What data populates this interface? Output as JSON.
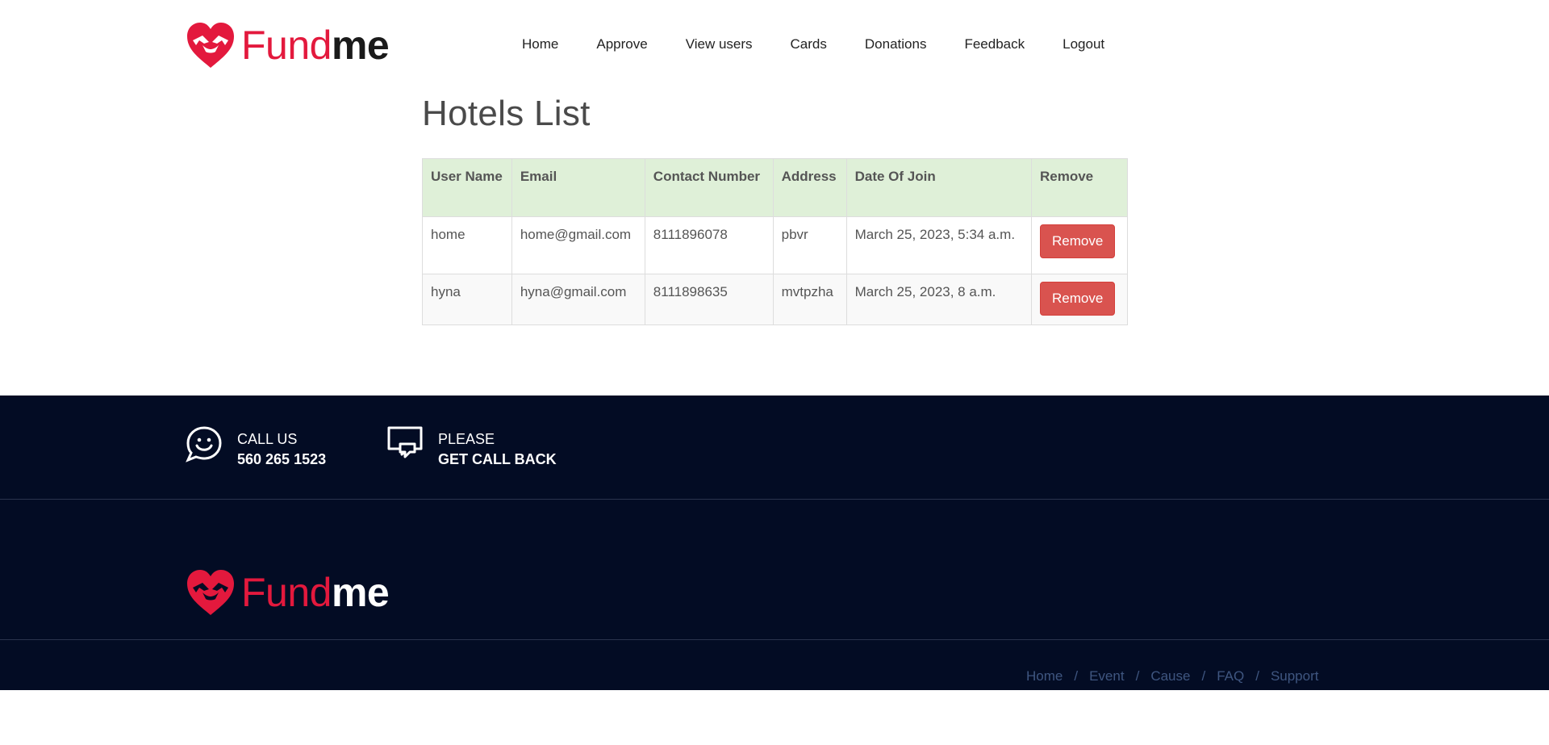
{
  "brand": {
    "name_part1": "Fund",
    "name_part2": "me",
    "accent_color": "#e3193d"
  },
  "nav": {
    "items": [
      "Home",
      "Approve",
      "View users",
      "Cards",
      "Donations",
      "Feedback",
      "Logout"
    ]
  },
  "main": {
    "title": "Hotels List",
    "table": {
      "headers": [
        "User Name",
        "Email",
        "Contact Number",
        "Address",
        "Date Of Join",
        "Remove"
      ],
      "rows": [
        {
          "user_name": "home",
          "email": "home@gmail.com",
          "contact": "8111896078",
          "address": "pbvr",
          "date_of_join": "March 25, 2023, 5:34 a.m.",
          "remove_label": "Remove"
        },
        {
          "user_name": "hyna",
          "email": "hyna@gmail.com",
          "contact": "8111898635",
          "address": "mvtpzha",
          "date_of_join": "March 25, 2023, 8 a.m.",
          "remove_label": "Remove"
        }
      ]
    },
    "header_color": "#dff0d8",
    "remove_button_color": "#d9534f"
  },
  "footer": {
    "background_color": "#030c24",
    "call_us": {
      "icon": "smiley-chat-icon",
      "line1": "CALL US",
      "line2": "560 265 1523"
    },
    "call_back": {
      "icon": "speech-bubbles-icon",
      "line1": "PLEASE",
      "line2": "GET CALL BACK"
    },
    "links": [
      "Home",
      "Event",
      "Cause",
      "FAQ",
      "Support"
    ],
    "link_separator": "/",
    "link_color": "#3f5680"
  }
}
